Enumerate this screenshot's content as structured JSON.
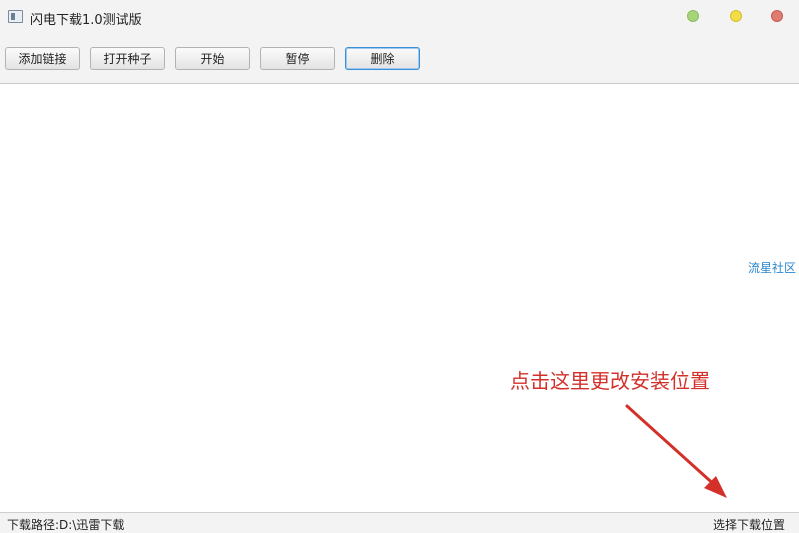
{
  "window": {
    "title": "闪电下载1.0测试版",
    "icon": "app-window-icon",
    "controls": [
      "minimize",
      "maximize",
      "close"
    ],
    "control_colors": {
      "minimize": "#a6d47a",
      "maximize": "#f1dc4a",
      "close": "#df7b6f"
    }
  },
  "toolbar": {
    "add_link_label": "添加链接",
    "open_torrent_label": "打开种子",
    "start_label": "开始",
    "pause_label": "暂停",
    "delete_label": "删除"
  },
  "content": {
    "side_link": "流星社区",
    "annotation": "点击这里更改安装位置",
    "annotation_color": "#d3302a"
  },
  "statusbar": {
    "download_path": "下载路径:D:\\迅雷下载",
    "choose_location_label": "选择下载位置"
  }
}
